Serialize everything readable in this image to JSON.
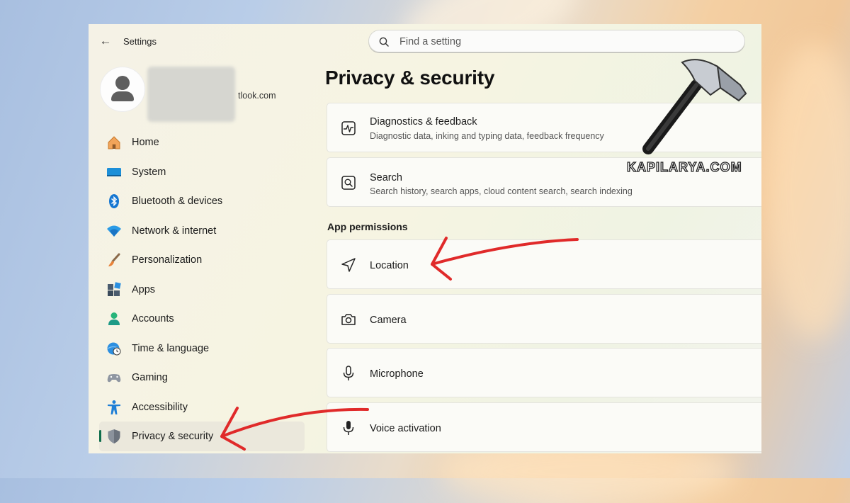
{
  "header": {
    "app_title": "Settings",
    "search_placeholder": "Find a setting"
  },
  "profile": {
    "email_fragment": "tlook.com"
  },
  "sidebar": {
    "items": [
      {
        "label": "Home",
        "icon": "home-icon"
      },
      {
        "label": "System",
        "icon": "display-icon"
      },
      {
        "label": "Bluetooth & devices",
        "icon": "bluetooth-icon"
      },
      {
        "label": "Network & internet",
        "icon": "wifi-icon"
      },
      {
        "label": "Personalization",
        "icon": "paintbrush-icon"
      },
      {
        "label": "Apps",
        "icon": "apps-icon"
      },
      {
        "label": "Accounts",
        "icon": "person-icon"
      },
      {
        "label": "Time & language",
        "icon": "clock-globe-icon"
      },
      {
        "label": "Gaming",
        "icon": "gamepad-icon"
      },
      {
        "label": "Accessibility",
        "icon": "accessibility-icon"
      },
      {
        "label": "Privacy & security",
        "icon": "shield-icon",
        "active": true
      }
    ]
  },
  "main": {
    "title": "Privacy & security",
    "cards": [
      {
        "title": "Diagnostics & feedback",
        "subtitle": "Diagnostic data, inking and typing data, feedback frequency",
        "icon": "pulse-icon"
      },
      {
        "title": "Search",
        "subtitle": "Search history, search apps, cloud content search, search indexing",
        "icon": "search-box-icon"
      }
    ],
    "section_label": "App permissions",
    "permissions": [
      {
        "title": "Location",
        "icon": "location-arrow-icon"
      },
      {
        "title": "Camera",
        "icon": "camera-icon"
      },
      {
        "title": "Microphone",
        "icon": "microphone-icon"
      },
      {
        "title": "Voice activation",
        "icon": "microphone-filled-icon"
      }
    ]
  },
  "watermark": {
    "text": "KAPILARYA.COM"
  },
  "colors": {
    "accent": "#0f6e4c",
    "annotation_arrow": "#e02a2a"
  }
}
